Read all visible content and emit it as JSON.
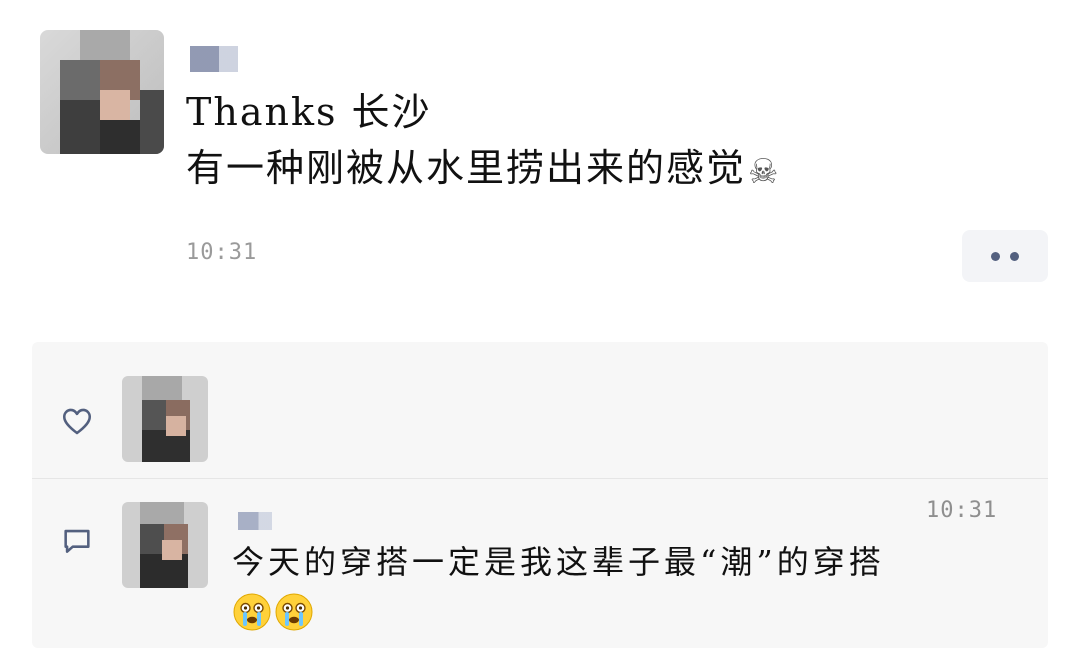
{
  "post": {
    "text_line1": "Thanks  长沙",
    "text_line2": "有一种刚被从水里捞出来的感觉",
    "emoji": "☠",
    "time": "10:31"
  },
  "comment": {
    "time": "10:31",
    "text": "今天的穿搭一定是我这辈子最“潮”的穿搭"
  },
  "icons": {
    "like": "heart-outline-icon",
    "comment": "comment-bubble-icon",
    "more": "more-dots-icon"
  },
  "colors": {
    "accent": "#53607f",
    "panel_bg": "#f7f7f7",
    "timestamp": "#9a9a9a"
  }
}
